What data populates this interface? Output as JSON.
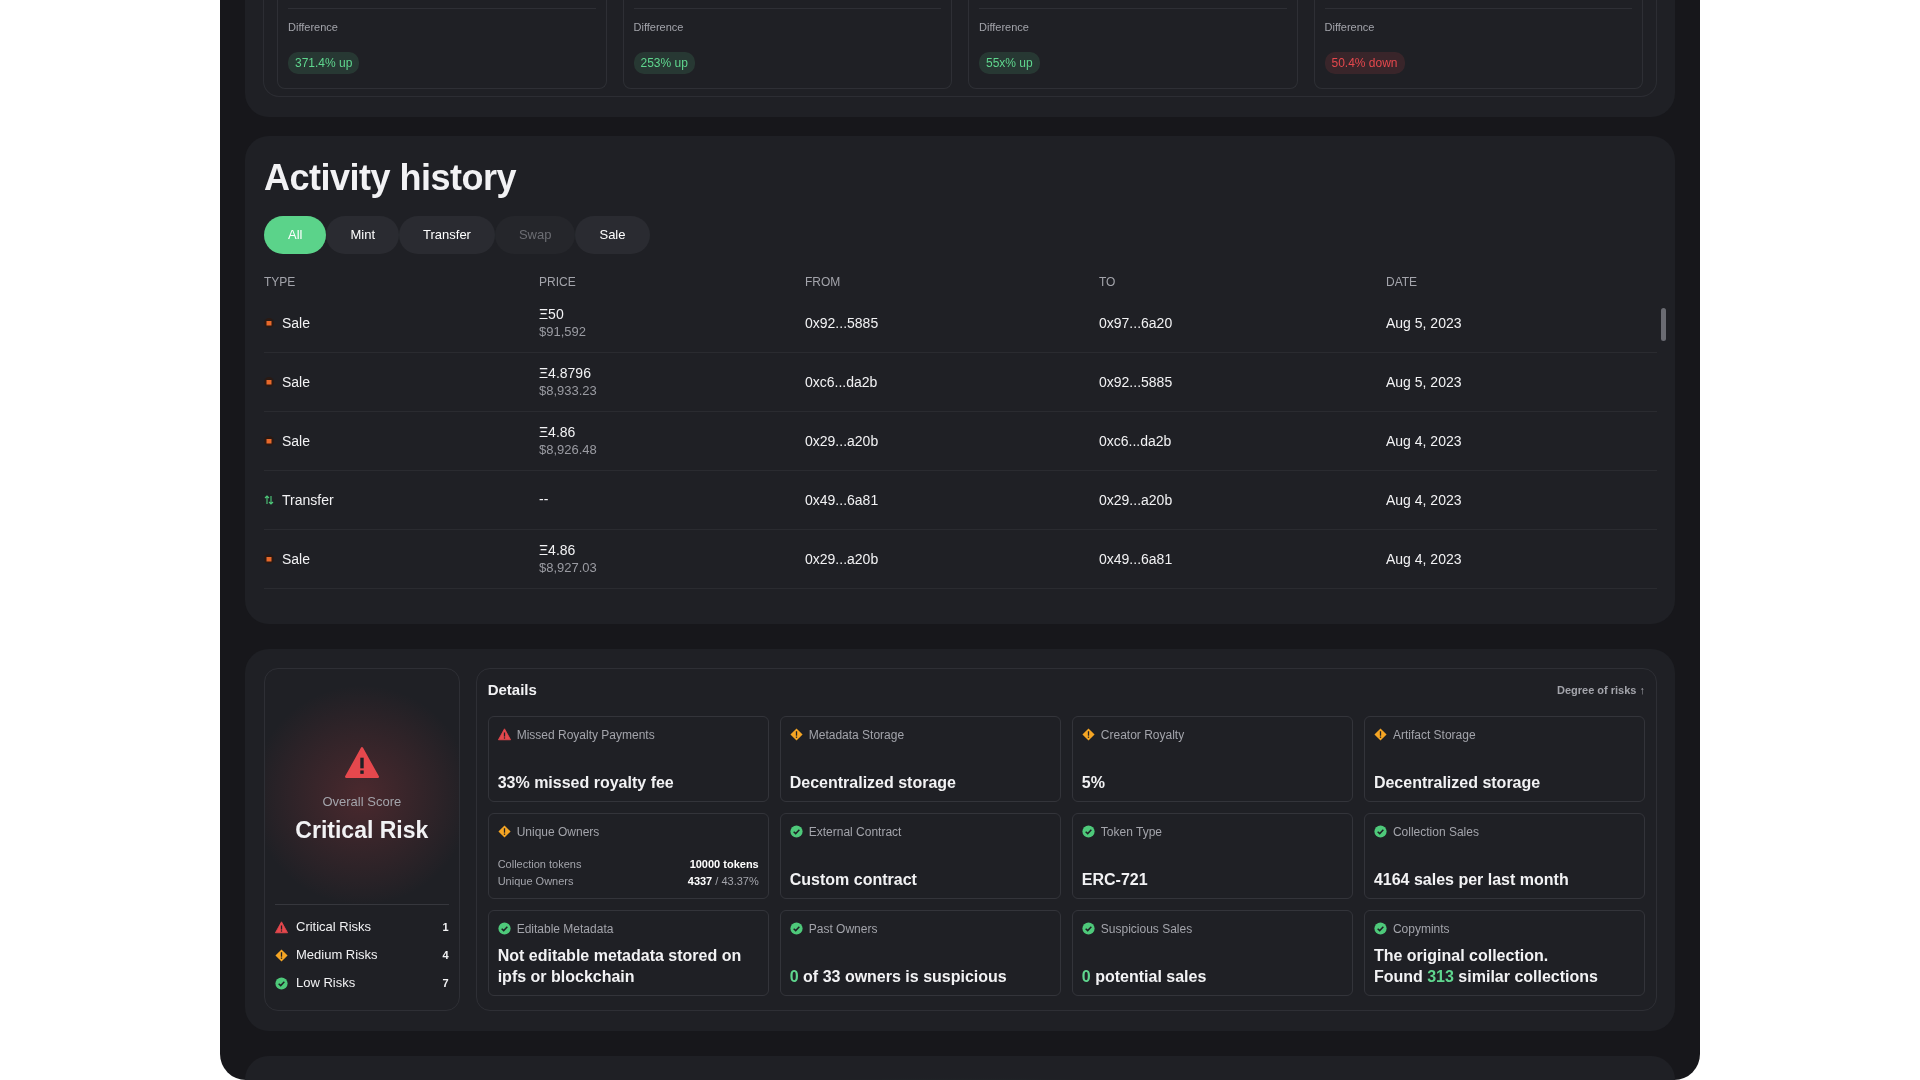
{
  "summary_cards": [
    {
      "label": "Difference",
      "change": "371.4% up",
      "color": "#5fd68e"
    },
    {
      "label": "Difference",
      "change": "253% up",
      "color": "#5fd68e"
    },
    {
      "label": "Difference",
      "change": "55x% up",
      "color": "#5fd68e"
    },
    {
      "label": "Difference",
      "change": "50.4% down",
      "color": "#e5484d"
    }
  ],
  "activity": {
    "title": "Activity history",
    "filters": [
      {
        "label": "All",
        "selected": true,
        "disabled": false
      },
      {
        "label": "Mint",
        "selected": false,
        "disabled": false
      },
      {
        "label": "Transfer",
        "selected": false,
        "disabled": false
      },
      {
        "label": "Swap",
        "selected": false,
        "disabled": true
      },
      {
        "label": "Sale",
        "selected": false,
        "disabled": false
      }
    ],
    "columns": [
      "TYPE",
      "PRICE",
      "FROM",
      "TO",
      "DATE"
    ],
    "rows": [
      {
        "kind": "sale",
        "type": "Sale",
        "price": "Ξ50",
        "price_usd": "$91,592",
        "from": "0x92...5885",
        "to": "0x97...6a20",
        "date": "Aug 5, 2023"
      },
      {
        "kind": "sale",
        "type": "Sale",
        "price": "Ξ4.8796",
        "price_usd": "$8,933.23",
        "from": "0xc6...da2b",
        "to": "0x92...5885",
        "date": "Aug 5, 2023"
      },
      {
        "kind": "sale",
        "type": "Sale",
        "price": "Ξ4.86",
        "price_usd": "$8,926.48",
        "from": "0x29...a20b",
        "to": "0xc6...da2b",
        "date": "Aug 4, 2023"
      },
      {
        "kind": "transfer",
        "type": "Transfer",
        "price": "--",
        "from": "0x49...6a81",
        "to": "0x29...a20b",
        "date": "Aug 4, 2023"
      },
      {
        "kind": "sale",
        "type": "Sale",
        "price": "Ξ4.86",
        "price_usd": "$8,927.03",
        "from": "0x29...a20b",
        "to": "0x49...6a81",
        "date": "Aug 4, 2023"
      }
    ]
  },
  "risk": {
    "overall": {
      "label": "Overall Score",
      "value": "Critical Risk",
      "color": "#e5484d"
    },
    "counts": [
      {
        "label": "Critical Risks",
        "count": "1",
        "color": "#e5484d"
      },
      {
        "label": "Medium Risks",
        "count": "4",
        "color": "#f5a524"
      },
      {
        "label": "Low Risks",
        "count": "7",
        "color": "#4ec97a"
      }
    ],
    "details": {
      "title": "Details",
      "sort": "Degree of risks ↑",
      "tiles": [
        {
          "kind": "text",
          "title": "Missed Royalty Payments",
          "color": "#e5484d",
          "value_lines": [
            [
              {
                "text": "33% missed royalty fee",
                "highlight": false
              }
            ]
          ]
        },
        {
          "kind": "text",
          "title": "Metadata Storage",
          "color": "#f5a524",
          "value_lines": [
            [
              {
                "text": "Decentralized storage",
                "highlight": false
              }
            ]
          ]
        },
        {
          "kind": "text",
          "title": "Creator Royalty",
          "color": "#f5a524",
          "value_lines": [
            [
              {
                "text": "5%",
                "highlight": false
              }
            ]
          ]
        },
        {
          "kind": "text",
          "title": "Artifact Storage",
          "color": "#f5a524",
          "value_lines": [
            [
              {
                "text": "Decentralized storage",
                "highlight": false
              }
            ]
          ]
        },
        {
          "kind": "stats",
          "title": "Unique Owners",
          "color": "#f5a524",
          "stats": [
            {
              "label": "Collection tokens",
              "value": "10000 tokens"
            },
            {
              "label": "Unique Owners",
              "value": "4337",
              "extra": "/ 43.37%"
            }
          ]
        },
        {
          "kind": "text",
          "title": "External Contract",
          "color": "#4ec97a",
          "value_lines": [
            [
              {
                "text": "Custom contract",
                "highlight": false
              }
            ]
          ]
        },
        {
          "kind": "text",
          "title": "Token Type",
          "color": "#4ec97a",
          "value_lines": [
            [
              {
                "text": "ERC-721",
                "highlight": false
              }
            ]
          ]
        },
        {
          "kind": "text",
          "title": "Collection Sales",
          "color": "#4ec97a",
          "value_lines": [
            [
              {
                "text": "4164 sales per last month",
                "highlight": false
              }
            ]
          ]
        },
        {
          "kind": "text",
          "title": "Editable Metadata",
          "color": "#4ec97a",
          "value_lines": [
            [
              {
                "text": "Not editable metadata stored on ipfs or blockchain",
                "highlight": false
              }
            ]
          ]
        },
        {
          "kind": "text",
          "title": "Past Owners",
          "color": "#4ec97a",
          "value_lines": [
            [
              {
                "text": "0",
                "highlight": true
              },
              {
                "text": " of 33 owners is suspicious",
                "highlight": false
              }
            ]
          ]
        },
        {
          "kind": "text",
          "title": "Suspicious Sales",
          "color": "#4ec97a",
          "value_lines": [
            [
              {
                "text": "0",
                "highlight": true
              },
              {
                "text": " potential sales",
                "highlight": false
              }
            ]
          ]
        },
        {
          "kind": "text",
          "title": "Copymints",
          "color": "#4ec97a",
          "value_lines": [
            [
              {
                "text": "The original collection.",
                "highlight": false
              }
            ],
            [
              {
                "text": "Found ",
                "highlight": false
              },
              {
                "text": "313",
                "highlight": true
              },
              {
                "text": " similar collections",
                "highlight": false
              }
            ]
          ]
        }
      ]
    }
  }
}
